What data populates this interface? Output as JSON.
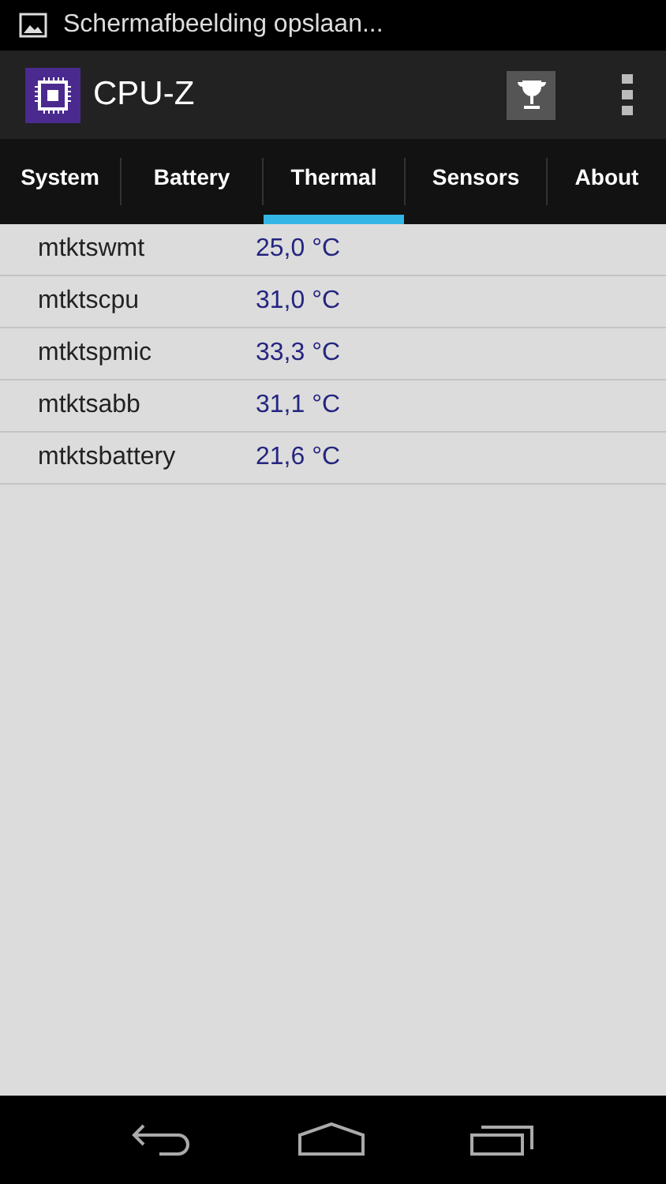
{
  "status_bar": {
    "notification": "Schermafbeelding opslaan..."
  },
  "app_bar": {
    "title": "CPU-Z"
  },
  "tabs": [
    {
      "label": "System",
      "selected": false
    },
    {
      "label": "Battery",
      "selected": false
    },
    {
      "label": "Thermal",
      "selected": true
    },
    {
      "label": "Sensors",
      "selected": false
    },
    {
      "label": "About",
      "selected": false
    }
  ],
  "sensors": [
    {
      "name": "mtktswmt",
      "value": "25,0 °C"
    },
    {
      "name": "mtktscpu",
      "value": "31,0 °C"
    },
    {
      "name": "mtktspmic",
      "value": "33,3 °C"
    },
    {
      "name": "mtktsabb",
      "value": "31,1 °C"
    },
    {
      "name": "mtktsbattery",
      "value": "21,6 °C"
    }
  ]
}
